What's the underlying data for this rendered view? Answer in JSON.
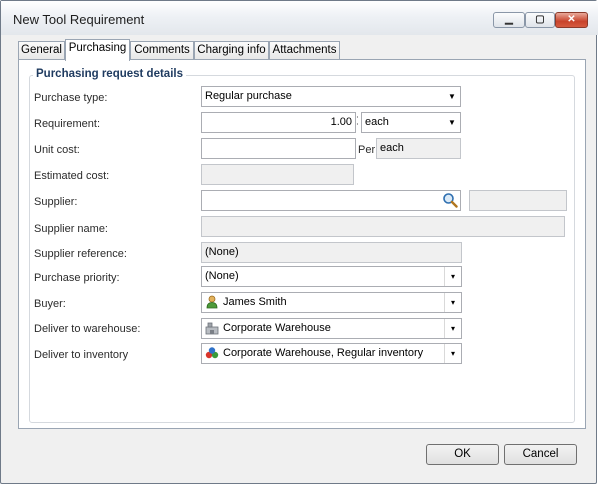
{
  "window": {
    "title": "New Tool Requirement"
  },
  "window_buttons": {
    "minimize": "▁",
    "maximize": "▢",
    "close": "✕"
  },
  "tabs": [
    "General",
    "Purchasing",
    "Comments",
    "Charging info",
    "Attachments"
  ],
  "active_tab": "Purchasing",
  "group_title": "Purchasing request details",
  "fields": {
    "purchase_type": {
      "label": "Purchase type:",
      "value": "Regular purchase"
    },
    "requirement": {
      "label": "Requirement:",
      "value": "1.00",
      "unit": "each"
    },
    "unit_cost": {
      "label": "Unit cost:",
      "value": "",
      "per_label": "Per",
      "per_unit": "each"
    },
    "estimated_cost": {
      "label": "Estimated cost:",
      "value": ""
    },
    "supplier": {
      "label": "Supplier:",
      "value": "",
      "extra": ""
    },
    "supplier_name": {
      "label": "Supplier name:",
      "value": ""
    },
    "supplier_reference": {
      "label": "Supplier reference:",
      "value": "(None)"
    },
    "purchase_priority": {
      "label": "Purchase priority:",
      "value": "(None)"
    },
    "buyer": {
      "label": "Buyer:",
      "value": "James Smith",
      "icon": "person-icon"
    },
    "deliver_to_warehouse": {
      "label": "Deliver to warehouse:",
      "value": "Corporate Warehouse",
      "icon": "warehouse-icon"
    },
    "deliver_to_inventory": {
      "label": "Deliver to inventory",
      "value": "Corporate Warehouse, Regular inventory",
      "icon": "inventory-icon"
    }
  },
  "buttons": {
    "ok": "OK",
    "cancel": "Cancel"
  }
}
